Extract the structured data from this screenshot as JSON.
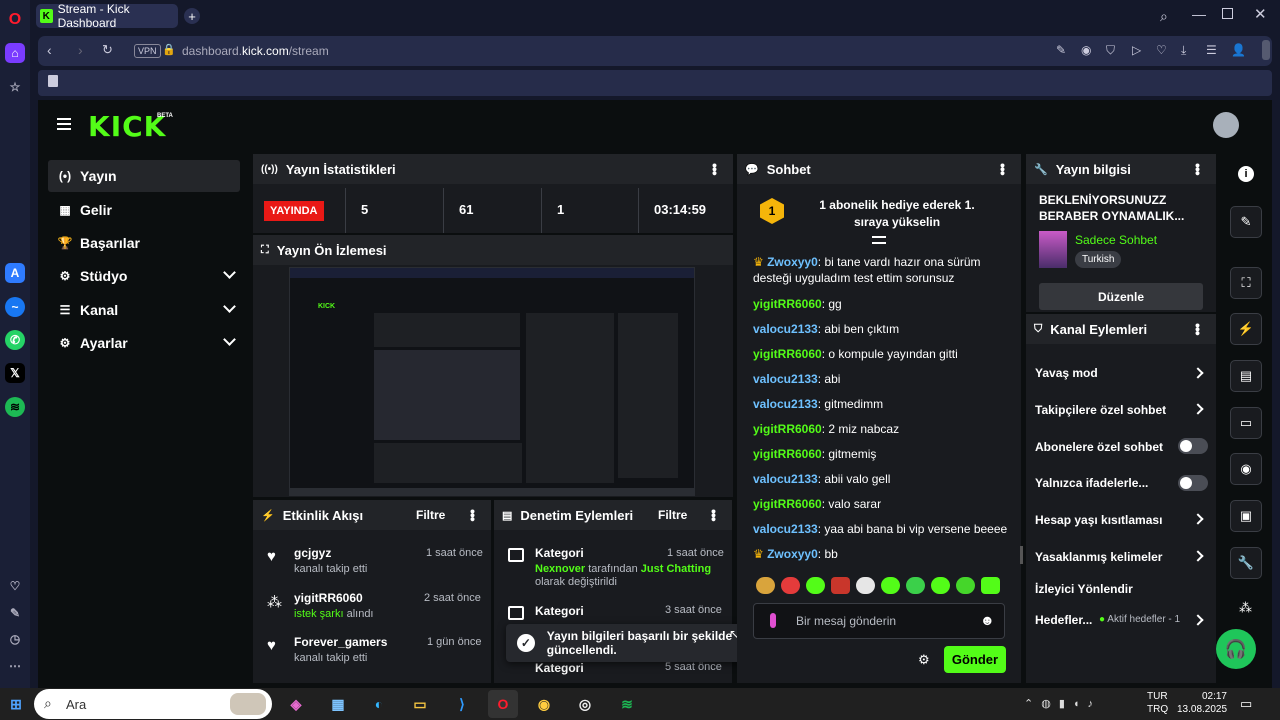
{
  "browser": {
    "tab_title": "Stream - Kick Dashboard",
    "new_tab": "+",
    "vpn": "VPN",
    "url_prefix": "dashboard.",
    "url_domain": "kick.com",
    "url_path": "/stream",
    "logo": "K",
    "brand_color": "#53fc18"
  },
  "kick": {
    "logo": "KICK",
    "beta": "BETA"
  },
  "sidebar": {
    "items": [
      {
        "label": "Yayın",
        "icon": "(•)"
      },
      {
        "label": "Gelir",
        "icon": "▦"
      },
      {
        "label": "Başarılar",
        "icon": "🏆"
      },
      {
        "label": "Stüdyo",
        "icon": "⚙"
      },
      {
        "label": "Kanal",
        "icon": "☰"
      },
      {
        "label": "Ayarlar",
        "icon": "⚙"
      }
    ]
  },
  "stats": {
    "title": "Yayın İstatistikleri",
    "live": "YAYINDA",
    "values": [
      "5",
      "61",
      "1",
      "03:14:59"
    ]
  },
  "preview": {
    "title": "Yayın Ön İzlemesi"
  },
  "activity": {
    "title": "Etkinlik Akışı",
    "filter": "Filtre",
    "items": [
      {
        "name": "gcjgyz",
        "desc": "kanalı takip etti",
        "time": "1 saat önce",
        "highlight": ""
      },
      {
        "name": "yigitRR6060",
        "desc": "alındı",
        "time": "2 saat önce",
        "highlight": "istek şarkı"
      },
      {
        "name": "Forever_gamers",
        "desc": "kanalı takip etti",
        "time": "1 gün önce",
        "highlight": ""
      }
    ]
  },
  "moderation": {
    "title": "Denetim Eylemleri",
    "filter": "Filtre",
    "items": [
      {
        "title": "Kategori",
        "time": "1 saat önce",
        "user": "Nexnover",
        "mid": " tarafından ",
        "category": "Just Chatting",
        "tail": "olarak değiştirildi"
      },
      {
        "title": "Kategori",
        "time": "3 saat önce"
      },
      {
        "title": "Kategori",
        "time": "5 saat önce"
      }
    ]
  },
  "toast": {
    "text": "Yayın bilgileri başarılı bir şekilde güncellendi."
  },
  "chat": {
    "title": "Sohbet",
    "pinned": "1 abonelik hediye ederek 1. sıraya yükselin",
    "badge": "1",
    "messages": [
      {
        "user": "Zwoxyy0",
        "text": "bi tane vardı hazır ona sürüm desteği uyguladım test ettim sorunsuz",
        "color": "#6ec1ff",
        "crown": true
      },
      {
        "user": "yigitRR6060",
        "text": "gg",
        "color": "#53fc18",
        "crown": false
      },
      {
        "user": "valocu2133",
        "text": "abi ben çıktım",
        "color": "#6ec1ff",
        "crown": false
      },
      {
        "user": "yigitRR6060",
        "text": "o kompule yayından gitti",
        "color": "#53fc18",
        "crown": false
      },
      {
        "user": "valocu2133",
        "text": "abi",
        "color": "#6ec1ff",
        "crown": false
      },
      {
        "user": "valocu2133",
        "text": "gitmedimm",
        "color": "#6ec1ff",
        "crown": false
      },
      {
        "user": "yigitRR6060",
        "text": "2 miz nabcaz",
        "color": "#53fc18",
        "crown": false
      },
      {
        "user": "yigitRR6060",
        "text": "gitmemiş",
        "color": "#53fc18",
        "crown": false
      },
      {
        "user": "valocu2133",
        "text": "abii valo gell",
        "color": "#6ec1ff",
        "crown": false
      },
      {
        "user": "yigitRR6060",
        "text": "valo sarar",
        "color": "#53fc18",
        "crown": false
      },
      {
        "user": "valocu2133",
        "text": "yaa abi bana bi vip versene beeee",
        "color": "#6ec1ff",
        "crown": false
      },
      {
        "user": "Zwoxyy0",
        "text": "bb",
        "color": "#6ec1ff",
        "crown": true
      }
    ],
    "placeholder": "Bir mesaj gönderin",
    "send": "Gönder"
  },
  "streaminfo": {
    "title": "Yayın bilgisi",
    "stream_title": "BEKLENİYORSUNUZZ BERABER OYNAMALIK...",
    "category": "Sadece Sohbet",
    "language": "Turkish",
    "edit": "Düzenle"
  },
  "channel": {
    "title": "Kanal Eylemleri",
    "items": [
      {
        "label": "Yavaş mod",
        "type": "chevron"
      },
      {
        "label": "Takipçilere özel sohbet",
        "type": "chevron"
      },
      {
        "label": "Abonelere özel sohbet",
        "type": "toggle"
      },
      {
        "label": "Yalnızca ifadelerle...",
        "type": "toggle"
      },
      {
        "label": "Hesap yaşı kısıtlaması",
        "type": "chevron"
      },
      {
        "label": "Yasaklanmış kelimeler",
        "type": "chevron"
      },
      {
        "label": "İzleyici Yönlendir",
        "type": "none"
      },
      {
        "label": "Hedefler...",
        "type": "chevron",
        "extra": "Aktif hedefler - 1"
      }
    ]
  },
  "taskbar": {
    "search": "Ara",
    "lang1": "TUR",
    "lang2": "TRQ",
    "time": "02:17",
    "date": "13.08.2025"
  }
}
